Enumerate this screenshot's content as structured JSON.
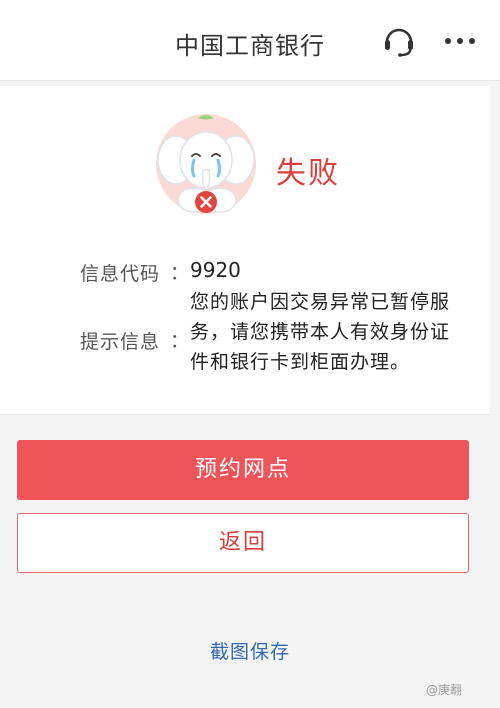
{
  "header": {
    "title": "中国工商银行",
    "service_icon": "customer-service-headset-icon",
    "more_icon": "more-dots-icon"
  },
  "result": {
    "status": "失败",
    "mascot_icon": "crying-elephant-mascot-with-x-badge",
    "code_label": "信息代码",
    "code_value": "9920",
    "message_label": "提示信息",
    "message_value": "您的账户因交易异常已暂停服务，请您携带本人有效身份证件和银行卡到柜面办理。",
    "colon": "："
  },
  "actions": {
    "primary_label": "预约网点",
    "secondary_label": "返回",
    "screenshot_label": "截图保存"
  },
  "watermark": "@庚翿",
  "colors": {
    "accent_red": "#f0545b",
    "status_red": "#d9403b",
    "link_blue": "#2f6ab1"
  }
}
